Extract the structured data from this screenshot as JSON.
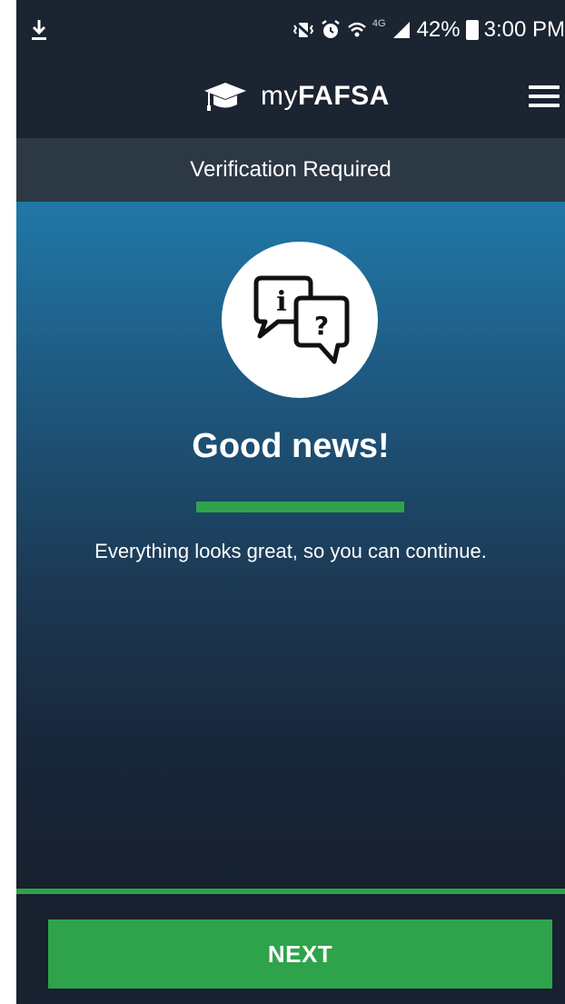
{
  "status_bar": {
    "download_icon": "download-icon",
    "mute_icon": "vibrate-mute-icon",
    "alarm_icon": "alarm-icon",
    "wifi_icon": "wifi-icon",
    "network_label": "4G",
    "signal_icon": "signal-icon",
    "battery_percent": "42%",
    "time": "3:00 PM"
  },
  "app_bar": {
    "logo_icon": "graduation-cap-icon",
    "brand_prefix": "my",
    "brand_bold": "FAFSA",
    "menu_icon": "hamburger-menu-icon"
  },
  "subheader": {
    "title": "Verification Required"
  },
  "content": {
    "illustration_icon": "info-question-speech-bubbles-icon",
    "info_glyph": "i",
    "question_glyph": "?",
    "headline": "Good news!",
    "message": "Everything looks great, so you can continue."
  },
  "footer": {
    "next_label": "NEXT"
  },
  "colors": {
    "accent_green": "#2ea34b",
    "header_bg": "#1b2431",
    "subheader_bg": "#2d3845",
    "gradient_top": "#2178a8",
    "gradient_bottom": "#17212f"
  }
}
